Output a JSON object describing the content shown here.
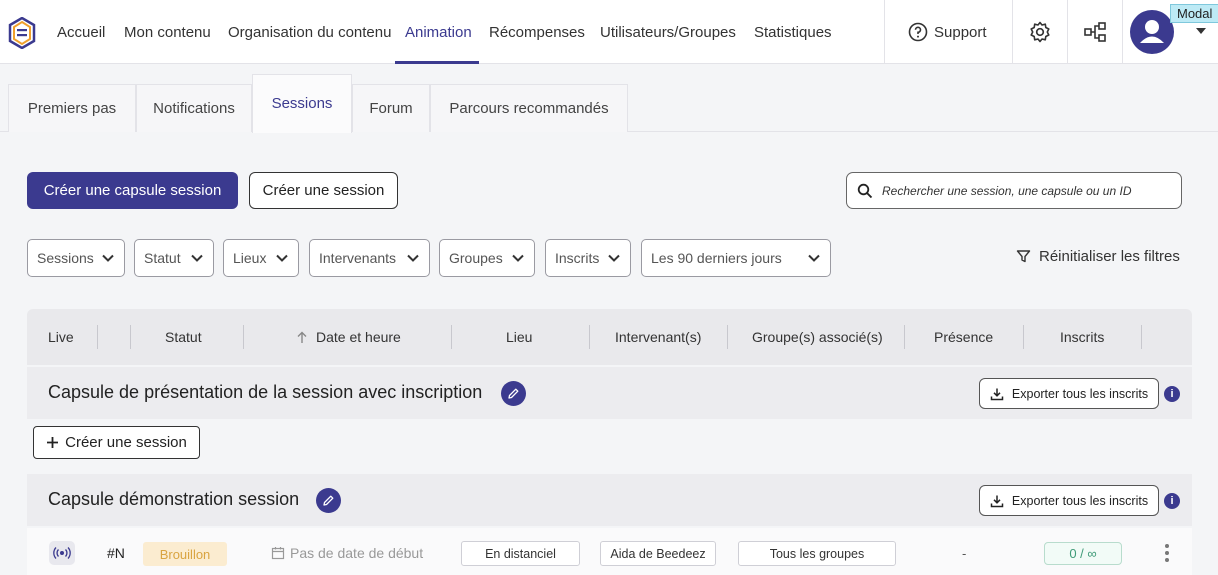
{
  "nav": {
    "items": [
      "Accueil",
      "Mon contenu",
      "Organisation du contenu",
      "Animation",
      "Récompenses",
      "Utilisateurs/Groupes",
      "Statistiques"
    ],
    "active": "Animation",
    "support_label": "Support",
    "modal_tag": "Modal",
    "accent_color": "#3b3a8f"
  },
  "tabs": {
    "items": [
      "Premiers pas",
      "Notifications",
      "Sessions",
      "Forum",
      "Parcours recommandés"
    ],
    "active": "Sessions"
  },
  "actions": {
    "create_capsule": "Créer une capsule session",
    "create_session": "Créer une session",
    "search_placeholder": "Rechercher une session, une capsule ou un ID"
  },
  "filters": {
    "items": [
      "Sessions",
      "Statut",
      "Lieux",
      "Intervenants",
      "Groupes",
      "Inscrits",
      "Les 90 derniers jours"
    ],
    "reset_label": "Réinitialiser les filtres"
  },
  "table": {
    "headers": [
      "Live",
      "Statut",
      "Date et heure",
      "Lieu",
      "Intervenant(s)",
      "Groupe(s) associé(s)",
      "Présence",
      "Inscrits"
    ],
    "capsules": [
      {
        "title": "Capsule de présentation de la session avec inscription",
        "export_label": "Exporter tous les inscrits",
        "info": "i"
      },
      {
        "title": "Capsule démonstration session",
        "export_label": "Exporter tous les inscrits",
        "info": "i"
      }
    ],
    "create_session_label": "Créer une session",
    "session_row": {
      "id": "#N",
      "status": "Brouillon",
      "date": "Pas de date de début",
      "location": "En distanciel",
      "speaker": "Aida de Beedeez",
      "groups": "Tous les groupes",
      "presence": "-",
      "inscrits": "0 / ∞"
    }
  }
}
